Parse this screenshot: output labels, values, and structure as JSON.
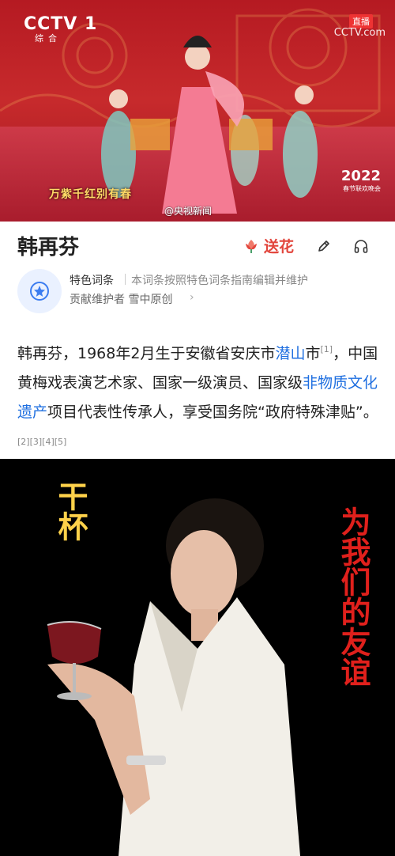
{
  "video": {
    "channel_logo": "CCTV 1",
    "channel_sub": "综合",
    "live_badge": "直播",
    "site_mark": "CCTV.com",
    "lyric": "万紫千红别有春",
    "event_logo": "2022",
    "event_sub": "春节联欢晚会",
    "watermark": "@央视新闻"
  },
  "header": {
    "title": "韩再芬",
    "flower_label": "送花"
  },
  "feature": {
    "title": "特色词条",
    "description": "本词条按照特色词条指南编辑并维护",
    "contributors": "贡献维护者 雪中原创",
    "chevron": "›"
  },
  "summary": {
    "part1": "韩再芬，1968年2月生于安徽省安庆市",
    "link1": "潜山",
    "part2": "市",
    "ref1": "[1]",
    "part3": "，中国黄梅戏表演艺术家、国家一级演员、国家级",
    "link2": "非物质文化遗产",
    "part4": "项目代表性传承人，享受国务院“政府特殊津贴”。",
    "refs": "[2][3][4][5]"
  },
  "photo": {
    "caption_left": "干杯",
    "caption_right": "为我们的友谊"
  },
  "colors": {
    "accent_red": "#e2453c",
    "link_blue": "#1f6fe0",
    "caption_gold": "#ffd24a",
    "caption_red": "#e0201c"
  }
}
